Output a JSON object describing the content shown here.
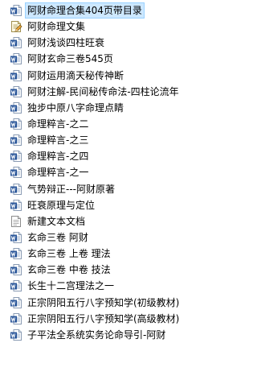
{
  "files": [
    {
      "name": "阿财命理合集404页带目录",
      "icon": "word-doc-icon",
      "selected": true
    },
    {
      "name": "阿财命理文集",
      "icon": "notepad-doc-icon",
      "selected": false
    },
    {
      "name": "阿财浅谈四柱旺衰",
      "icon": "word-doc-icon",
      "selected": false
    },
    {
      "name": "阿财玄命三卷545页",
      "icon": "word-doc-icon",
      "selected": false
    },
    {
      "name": "阿财运用滴天秘传神断",
      "icon": "word-doc-icon",
      "selected": false
    },
    {
      "name": "阿财注解-民间秘传命法-四柱论流年",
      "icon": "word-doc-icon",
      "selected": false
    },
    {
      "name": "独步中原八字命理点睛",
      "icon": "word-doc-icon",
      "selected": false
    },
    {
      "name": "命理粹言-之二",
      "icon": "word-doc-icon",
      "selected": false
    },
    {
      "name": "命理粹言-之三",
      "icon": "word-doc-icon",
      "selected": false
    },
    {
      "name": "命理粹言-之四",
      "icon": "word-doc-icon",
      "selected": false
    },
    {
      "name": "命理粹言-之一",
      "icon": "word-doc-icon",
      "selected": false
    },
    {
      "name": "气势辩正---阿财原著",
      "icon": "word-doc-icon",
      "selected": false
    },
    {
      "name": "旺衰原理与定位",
      "icon": "word-doc-icon",
      "selected": false
    },
    {
      "name": "新建文本文档",
      "icon": "text-doc-icon",
      "selected": false
    },
    {
      "name": "玄命三卷 阿财",
      "icon": "word-doc-icon",
      "selected": false
    },
    {
      "name": "玄命三卷 上卷 理法",
      "icon": "word-doc-icon",
      "selected": false
    },
    {
      "name": "玄命三卷 中卷 技法",
      "icon": "word-doc-icon",
      "selected": false
    },
    {
      "name": "长生十二宫理法之一",
      "icon": "word-doc-icon",
      "selected": false
    },
    {
      "name": "正宗阴阳五行八字预知学(初级教材)",
      "icon": "word-doc-icon",
      "selected": false
    },
    {
      "name": "正宗阴阳五行八字预知学(高级教材)",
      "icon": "word-doc-icon",
      "selected": false
    },
    {
      "name": "子平法全系统实务论命导引-阿财",
      "icon": "word-doc-icon",
      "selected": false
    }
  ],
  "colors": {
    "selection_fill": "#cde8ff",
    "selection_border": "#99d1ff",
    "word_blue": "#2b579a"
  }
}
